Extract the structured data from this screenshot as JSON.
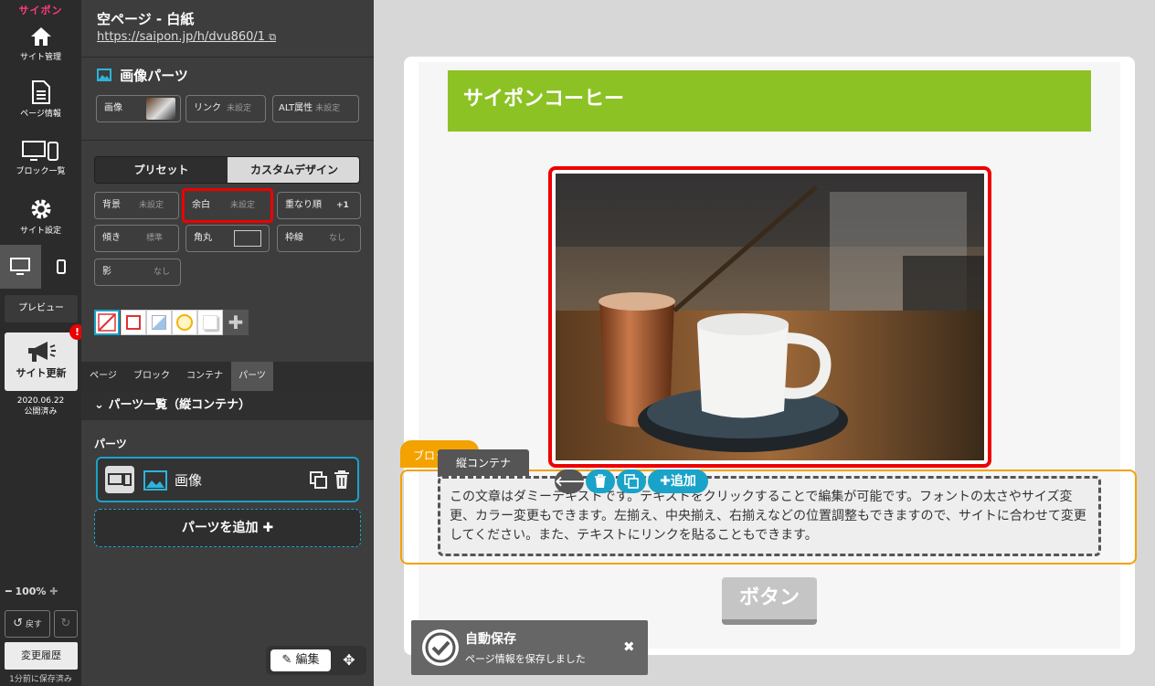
{
  "rail": {
    "logo": "サイポン",
    "nav": [
      {
        "label": "サイト管理",
        "icon": "home-icon"
      },
      {
        "label": "ページ情報",
        "icon": "document-icon"
      },
      {
        "label": "ブロック一覧",
        "icon": "devices-icon"
      },
      {
        "label": "サイト設定",
        "icon": "gear-icon"
      }
    ],
    "preview_label": "プレビュー",
    "update_label": "サイト更新",
    "badge": "!",
    "publish_date": "2020.06.22",
    "publish_status": "公開済み",
    "zoom": "100%",
    "undo_label": "戻す",
    "history_label": "変更履歴",
    "autosave_note": "1分前に保存済み"
  },
  "panel": {
    "page_title": "空ページ - 白紙",
    "page_url": "https://saipon.jp/h/dvu860/1",
    "section_title": "画像パーツ",
    "chips": {
      "image": "画像",
      "link": "リンク",
      "link_val": "未設定",
      "alt": "ALT属性",
      "alt_val": "未設定"
    },
    "tabs": {
      "preset": "プリセット",
      "custom": "カスタムデザイン"
    },
    "design": {
      "bg": "背景",
      "bg_val": "未設定",
      "margin": "余白",
      "margin_val": "未設定",
      "order": "重なり順",
      "order_val": "+1",
      "tilt": "傾き",
      "tilt_val": "標準",
      "radius": "角丸",
      "border": "枠線",
      "border_val": "なし",
      "shadow": "影",
      "shadow_val": "なし"
    },
    "lower_tabs": [
      "ページ",
      "ブロック",
      "コンテナ",
      "パーツ"
    ],
    "parts_header": "パーツ一覧（縦コンテナ）",
    "parts_label": "パーツ",
    "part_item": "画像",
    "add_parts": "パーツを追加",
    "edit_label": "編集"
  },
  "canvas": {
    "heading": "サイポンコーヒー",
    "block_tag": "ブロック",
    "container_tag": "縦コンテナ",
    "add_label": "追加",
    "body_text": "この文章はダミーテキストです。テキストをクリックすることで編集が可能です。フォントの太さやサイズ変更、カラー変更もできます。左揃え、中央揃え、右揃えなどの位置調整もできますので、サイトに合わせて変更してください。また、テキストにリンクを貼ることもできます。",
    "button_label": "ボタン",
    "toast_title": "自動保存",
    "toast_msg": "ページ情報を保存しました"
  },
  "colors": {
    "accent": "#1aa3c8",
    "title_green": "#8cc224",
    "block_orange": "#f3a200",
    "selection_red": "#e00000"
  }
}
